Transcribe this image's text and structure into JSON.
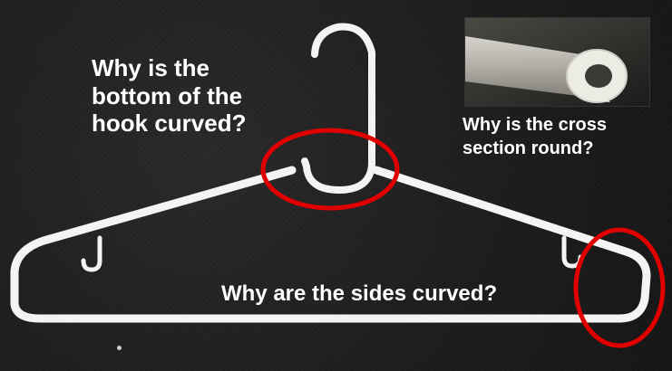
{
  "colors": {
    "background": "#1e1e1f",
    "hanger": "#ffffff",
    "highlight_circle": "#e00000",
    "text": "#ffffff"
  },
  "questions": {
    "hook": [
      "Why is the",
      "bottom of the",
      "hook curved?"
    ],
    "cross_section": [
      "Why is the cross",
      "section round?"
    ],
    "sides": "Why are the sides curved?"
  }
}
